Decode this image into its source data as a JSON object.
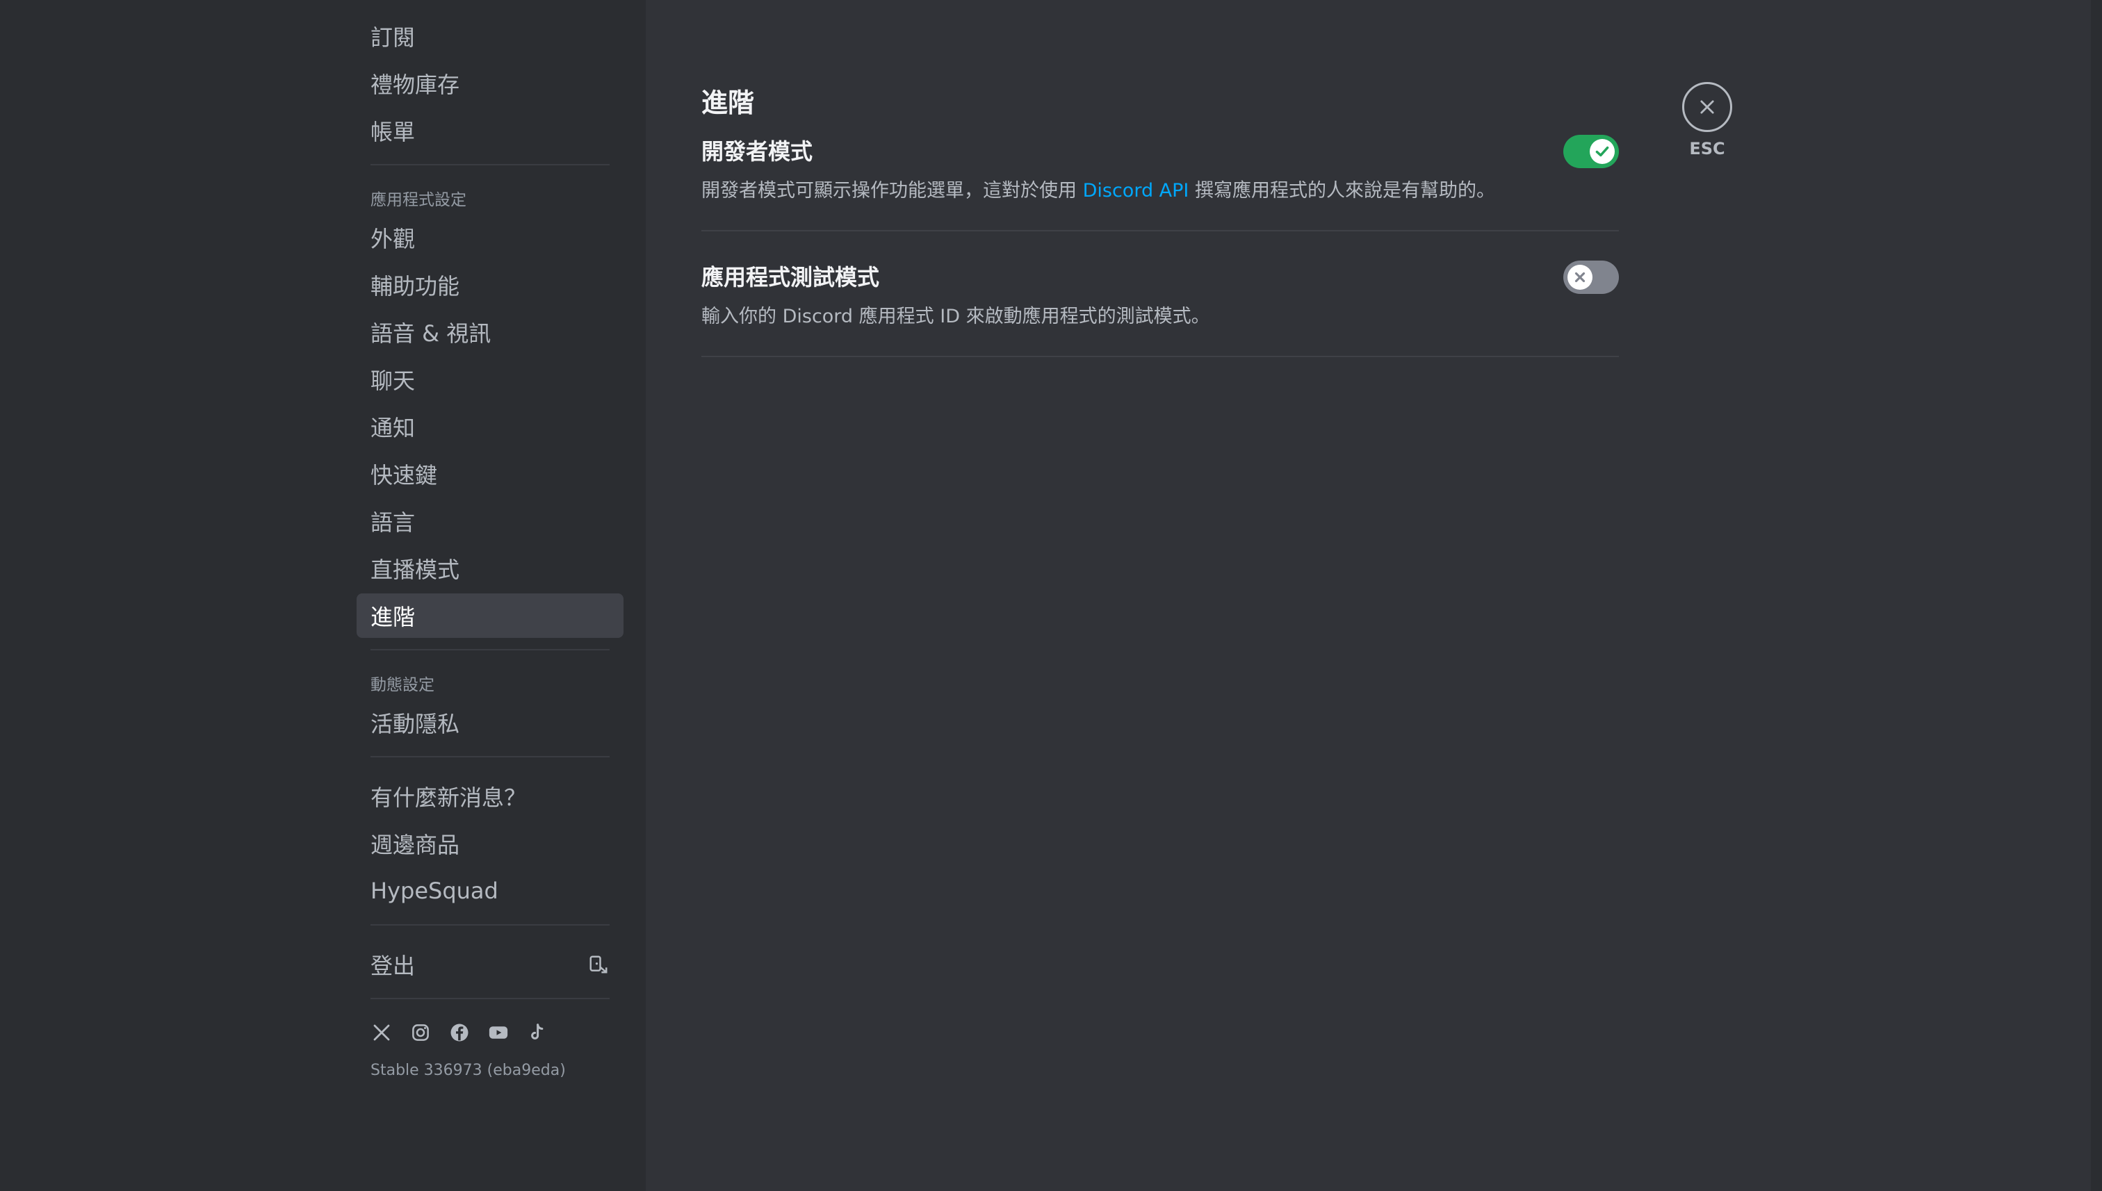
{
  "sidebar": {
    "top_items": [
      {
        "label": "訂閱"
      },
      {
        "label": "禮物庫存"
      },
      {
        "label": "帳單"
      }
    ],
    "app_settings_header": "應用程式設定",
    "app_settings_items": [
      {
        "label": "外觀"
      },
      {
        "label": "輔助功能"
      },
      {
        "label": "語音 & 視訊"
      },
      {
        "label": "聊天"
      },
      {
        "label": "通知"
      },
      {
        "label": "快速鍵"
      },
      {
        "label": "語言"
      },
      {
        "label": "直播模式"
      },
      {
        "label": "進階",
        "selected": true
      }
    ],
    "activity_header": "動態設定",
    "activity_items": [
      {
        "label": "活動隱私"
      }
    ],
    "misc_items": [
      {
        "label": "有什麼新消息？"
      },
      {
        "label": "週邊商品"
      },
      {
        "label": "HypeSquad"
      }
    ],
    "logout_label": "登出",
    "social_icons": [
      "x-icon",
      "instagram-icon",
      "facebook-icon",
      "youtube-icon",
      "tiktok-icon"
    ],
    "build_info": "Stable 336973 (eba9eda)"
  },
  "main": {
    "title": "進階",
    "settings": [
      {
        "title": "開發者模式",
        "desc_before": "開發者模式可顯示操作功能選單，這對於使用 ",
        "desc_link": "Discord API",
        "desc_after": " 撰寫應用程式的人來說是有幫助的。",
        "enabled": true
      },
      {
        "title": "應用程式測試模式",
        "desc": "輸入你的 Discord 應用程式 ID 來啟動應用程式的測試模式。",
        "enabled": false
      }
    ]
  },
  "close": {
    "label": "ESC"
  },
  "colors": {
    "background": "#313338",
    "sidebar": "#2b2d31",
    "selected_item": "#404249",
    "toggle_on": "#23a55a",
    "toggle_off": "#80848e",
    "link": "#00a8fc"
  }
}
